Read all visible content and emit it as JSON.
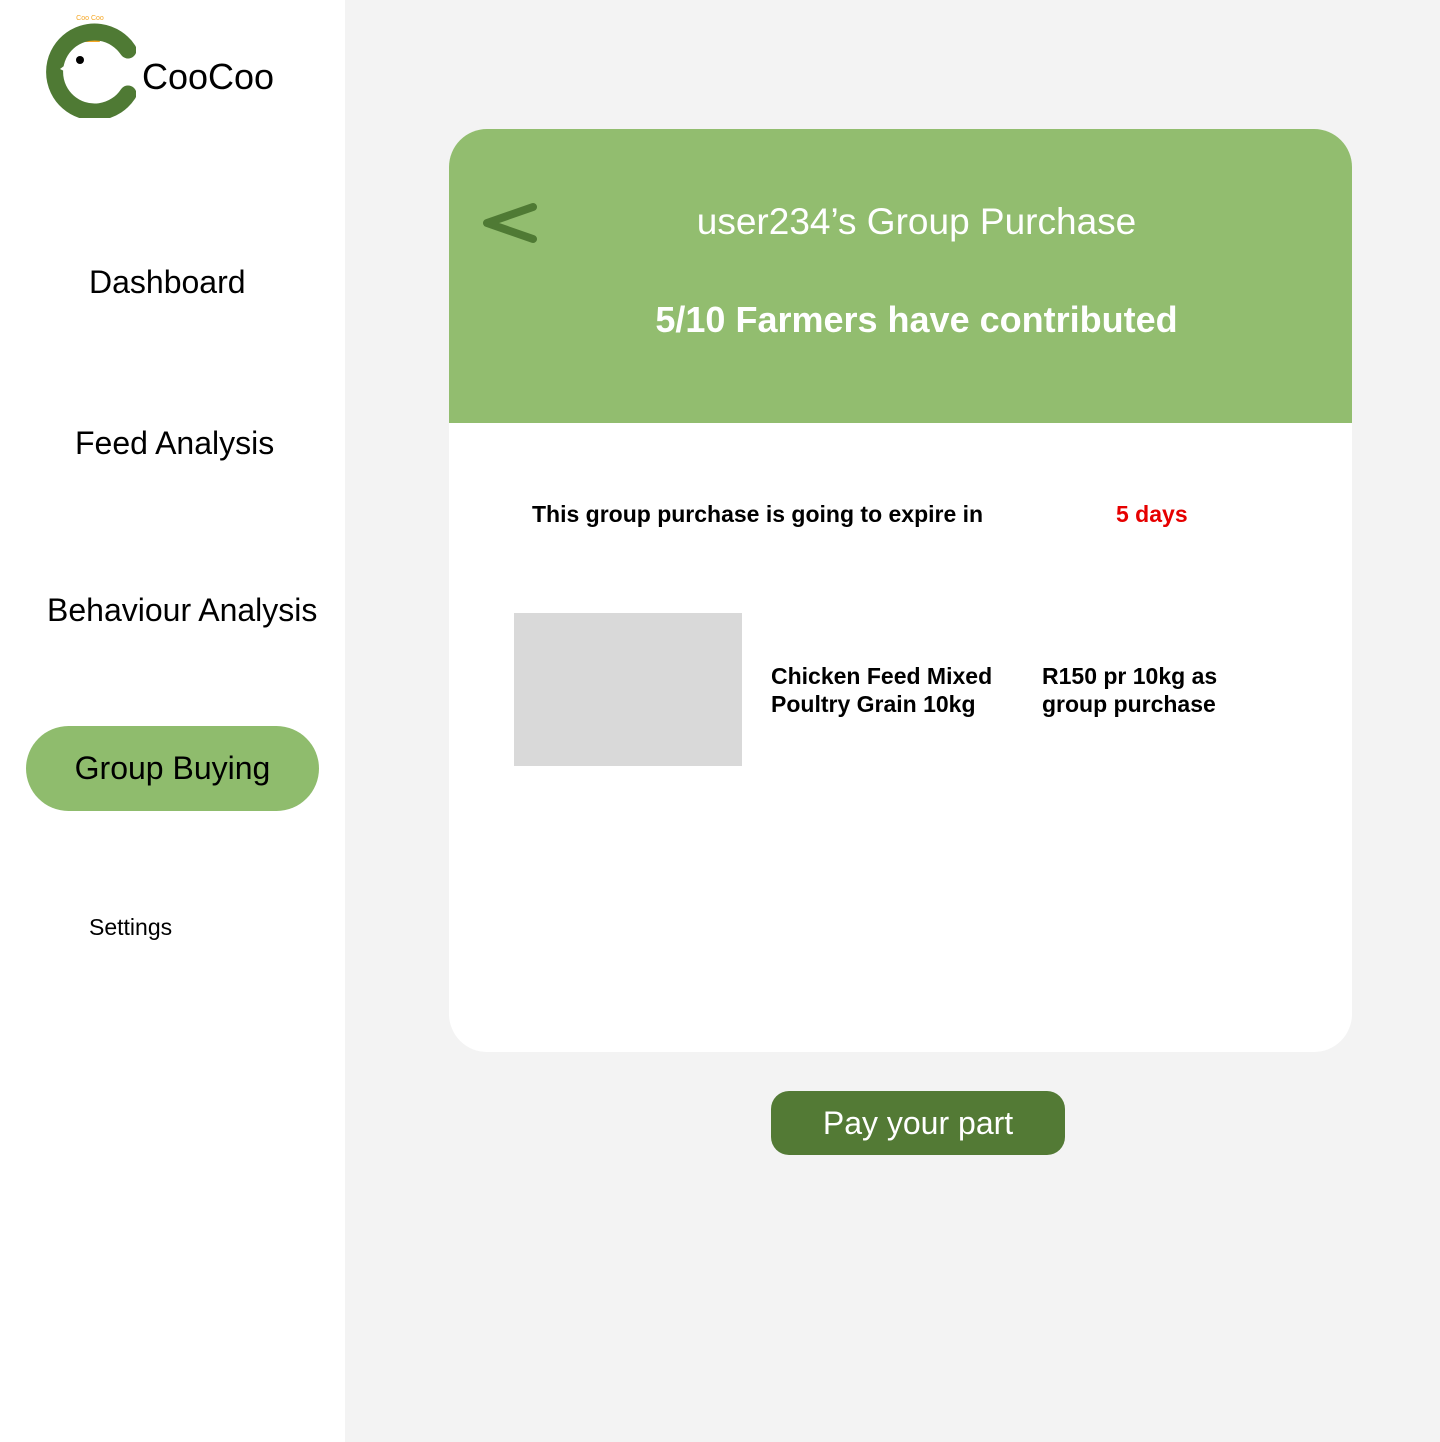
{
  "brand": {
    "name": "CooCoo",
    "logo_text": "Coo Coo",
    "logo_color": "#4f7a34",
    "crown_color": "#f5a623"
  },
  "sidebar": {
    "items": [
      {
        "label": "Dashboard",
        "active": false
      },
      {
        "label": "Feed Analysis",
        "active": false
      },
      {
        "label": "Behaviour Analysis",
        "active": false
      },
      {
        "label": "Group Buying",
        "active": true
      },
      {
        "label": "Settings",
        "active": false
      }
    ],
    "active_color": "#8fbc6d"
  },
  "group_purchase": {
    "title": "user234’s Group Purchase",
    "contribution_status": "5/10 Farmers have contributed",
    "contributed": 5,
    "total": 10,
    "expiry_text": "This group purchase is going to expire in",
    "expiry_value": "5 days",
    "header_color": "#92bd6f",
    "expiry_color": "#e60000"
  },
  "product": {
    "name": "Chicken Feed Mixed Poultry Grain 10kg",
    "price": "R150 pr 10kg as group purchase",
    "image_placeholder_color": "#d9d9d9"
  },
  "actions": {
    "pay_label": "Pay your part",
    "pay_color": "#537a35"
  },
  "icons": {
    "back": "back-arrow-icon"
  }
}
